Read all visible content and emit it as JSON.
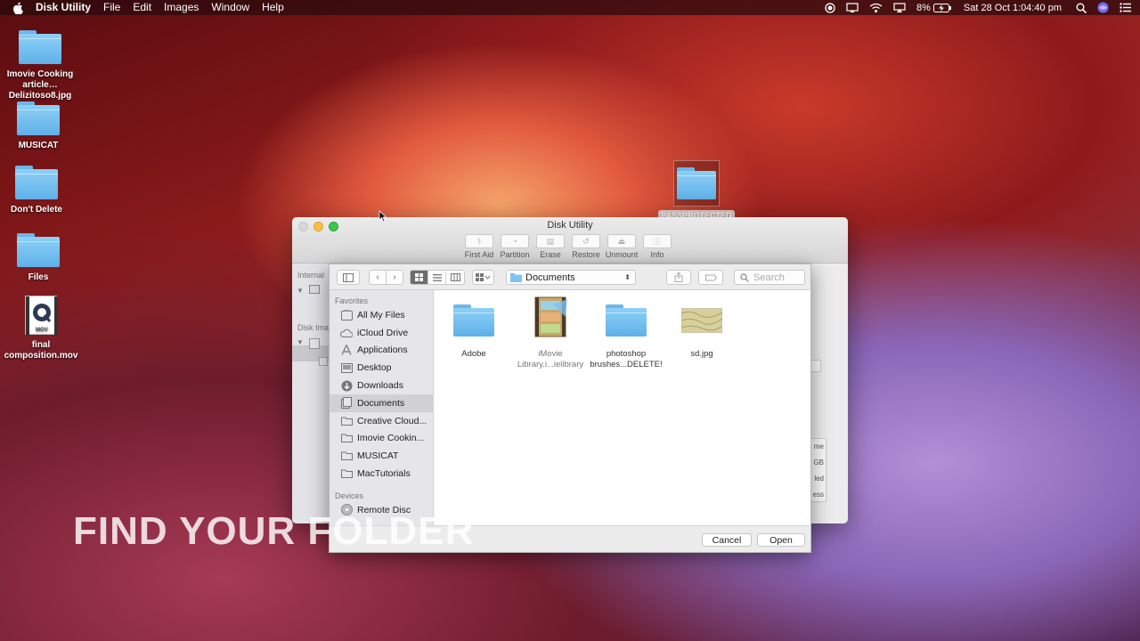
{
  "menubar": {
    "app_name": "Disk Utility",
    "items": [
      "File",
      "Edit",
      "Images",
      "Window",
      "Help"
    ],
    "battery": "8%",
    "clock": "Sat 28 Oct  1:04:40 pm"
  },
  "desktop": {
    "icons": [
      {
        "label": "Imovie Cooking\narticle…Delizitoso8.jpg",
        "kind": "folder"
      },
      {
        "label": "MUSICAT",
        "kind": "folder"
      },
      {
        "label": "Don't Delete",
        "kind": "folder"
      },
      {
        "label": "Files",
        "kind": "folder"
      },
      {
        "label": "final composition.mov",
        "kind": "movie"
      }
    ],
    "drag_folder_label": "PASSPROTECTED"
  },
  "disk_utility": {
    "title": "Disk Utility",
    "tools": [
      "First Aid",
      "Partition",
      "Erase",
      "Restore",
      "Unmount",
      "Info"
    ],
    "sidebar_headers": [
      "Internal",
      "Disk Ima"
    ],
    "partial_labels": [
      "me",
      "GB",
      "led",
      "ess"
    ]
  },
  "open_panel": {
    "path": "Documents",
    "search_placeholder": "Search",
    "favorites_header": "Favorites",
    "devices_header": "Devices",
    "favorites": [
      {
        "label": "All My Files",
        "icon": "all-files-icon"
      },
      {
        "label": "iCloud Drive",
        "icon": "cloud-icon"
      },
      {
        "label": "Applications",
        "icon": "applications-icon"
      },
      {
        "label": "Desktop",
        "icon": "desktop-icon"
      },
      {
        "label": "Downloads",
        "icon": "downloads-icon"
      },
      {
        "label": "Documents",
        "icon": "documents-icon",
        "selected": true
      },
      {
        "label": "Creative Cloud...",
        "icon": "folder-icon"
      },
      {
        "label": "Imovie Cookin...",
        "icon": "folder-icon"
      },
      {
        "label": "MUSICAT",
        "icon": "folder-icon"
      },
      {
        "label": "MacTutorials",
        "icon": "folder-icon"
      }
    ],
    "devices": [
      {
        "label": "Remote Disc",
        "icon": "disc-icon"
      }
    ],
    "files": [
      {
        "label": "Adobe",
        "kind": "folder"
      },
      {
        "label": "iMovie\nLibrary.i...ielibrary",
        "kind": "imovie"
      },
      {
        "label": "photoshop\nbrushes...DELETE!",
        "kind": "folder"
      },
      {
        "label": "sd.jpg",
        "kind": "image"
      }
    ],
    "cancel_label": "Cancel",
    "open_label": "Open"
  },
  "overlay": {
    "caption": "FIND YOUR FOLDER"
  }
}
